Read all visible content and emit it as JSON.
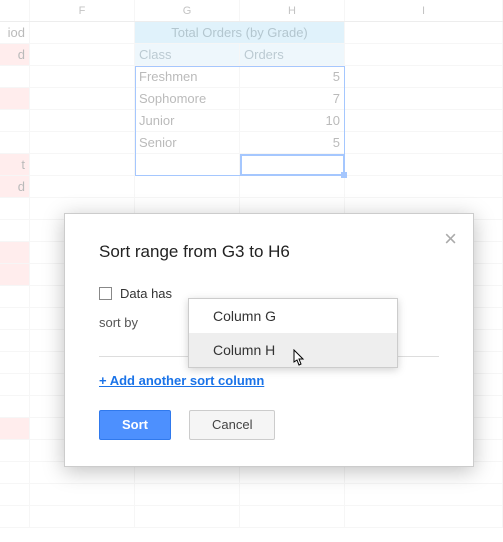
{
  "columns": {
    "F": "F",
    "G": "G",
    "H": "H",
    "I": "I"
  },
  "leftStubs": {
    "r1": "iod",
    "r2": "d",
    "r7": "t",
    "r8": "d"
  },
  "table": {
    "title": "Total Orders (by Grade)",
    "headers": {
      "class": "Class",
      "orders": "Orders"
    },
    "rows": [
      {
        "class": "Freshmen",
        "orders": "5"
      },
      {
        "class": "Sophomore",
        "orders": "7"
      },
      {
        "class": "Junior",
        "orders": "10"
      },
      {
        "class": "Senior",
        "orders": "5"
      }
    ]
  },
  "dialog": {
    "title": "Sort range from G3 to H6",
    "checkbox_label": "Data has",
    "sortby_label": "sort by",
    "dropdown": {
      "opt1": "Column G",
      "opt2": "Column H"
    },
    "add_link": "+ Add another sort column",
    "sort_btn": "Sort",
    "cancel_btn": "Cancel"
  }
}
